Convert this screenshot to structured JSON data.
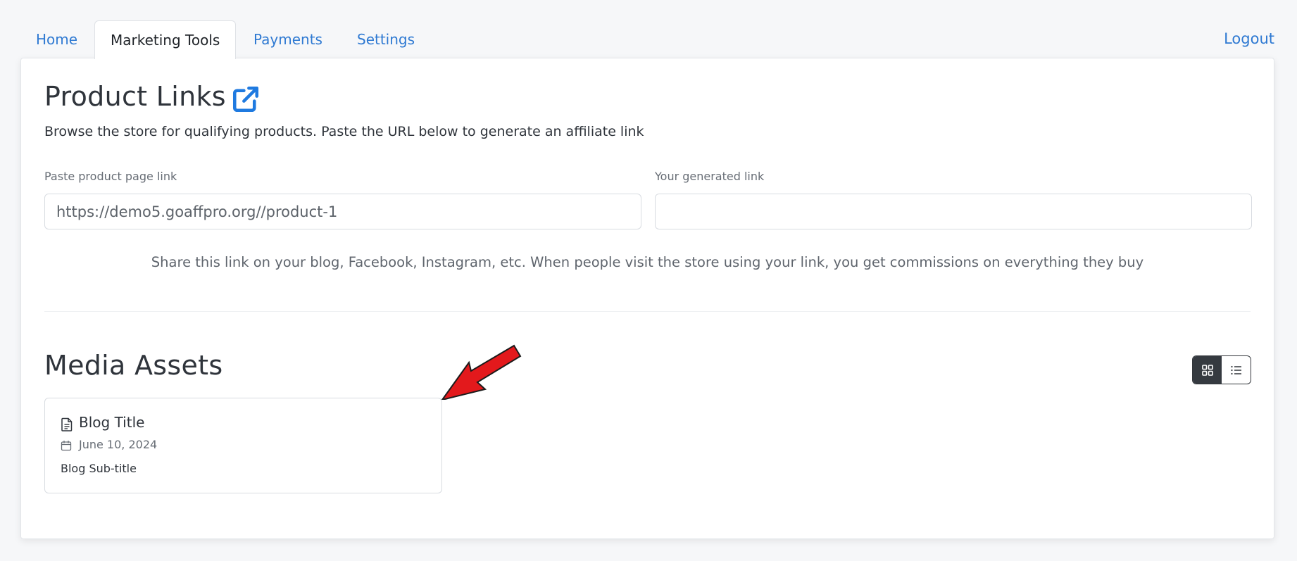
{
  "nav": {
    "tabs": [
      {
        "label": "Home"
      },
      {
        "label": "Marketing Tools"
      },
      {
        "label": "Payments"
      },
      {
        "label": "Settings"
      }
    ],
    "logout_label": "Logout"
  },
  "product_links": {
    "title": "Product Links",
    "description": "Browse the store for qualifying products. Paste the URL below to generate an affiliate link",
    "paste_label": "Paste product page link",
    "paste_value": "https://demo5.goaffpro.org//product-1",
    "generated_label": "Your generated link",
    "generated_value": "",
    "help_text": "Share this link on your blog, Facebook, Instagram, etc. When people visit the store using your link, you get commissions on everything they buy"
  },
  "media_assets": {
    "title": "Media Assets",
    "view_mode": "grid",
    "items": [
      {
        "title": "Blog Title",
        "date": "June 10, 2024",
        "subtitle": "Blog Sub-title",
        "icon": "document-icon"
      }
    ]
  },
  "colors": {
    "link": "#2e79d2",
    "annotation_arrow": "#e3191c"
  }
}
